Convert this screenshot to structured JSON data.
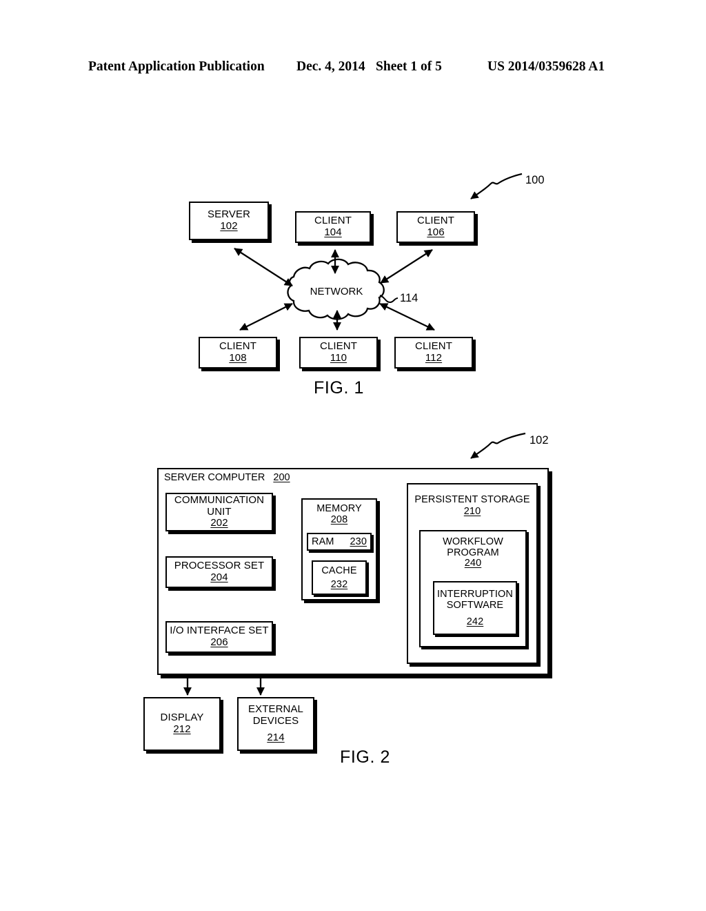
{
  "header": {
    "title": "Patent Application Publication",
    "date": "Dec. 4, 2014",
    "sheet": "Sheet 1 of 5",
    "publication_number": "US 2014/0359628 A1"
  },
  "figure1": {
    "caption": "FIG. 1",
    "system_ref": "100",
    "network": {
      "label": "NETWORK",
      "ref": "114"
    },
    "nodes": [
      {
        "label": "SERVER",
        "num": "102"
      },
      {
        "label": "CLIENT",
        "num": "104"
      },
      {
        "label": "CLIENT",
        "num": "106"
      },
      {
        "label": "CLIENT",
        "num": "108"
      },
      {
        "label": "CLIENT",
        "num": "110"
      },
      {
        "label": "CLIENT",
        "num": "112"
      }
    ]
  },
  "figure2": {
    "caption": "FIG. 2",
    "system_ref": "102",
    "container": {
      "label": "SERVER COMPUTER",
      "num": "200"
    },
    "blocks": {
      "communication_unit": {
        "line1": "COMMUNICATION",
        "line2": "UNIT",
        "num": "202"
      },
      "processor_set": {
        "label": "PROCESSOR SET",
        "num": "204"
      },
      "io_interface_set": {
        "label": "I/O INTERFACE SET",
        "num": "206"
      },
      "memory": {
        "label": "MEMORY",
        "num": "208"
      },
      "ram": {
        "label": "RAM",
        "num": "230"
      },
      "cache": {
        "label": "CACHE",
        "num": "232"
      },
      "persistent_storage": {
        "label": "PERSISTENT STORAGE",
        "num": "210"
      },
      "workflow_program": {
        "line1": "WORKFLOW",
        "line2": "PROGRAM",
        "num": "240"
      },
      "interruption_software": {
        "line1": "INTERRUPTION",
        "line2": "SOFTWARE",
        "num": "242"
      },
      "display": {
        "label": "DISPLAY",
        "num": "212"
      },
      "external_devices": {
        "line1": "EXTERNAL",
        "line2": "DEVICES",
        "num": "214"
      }
    }
  }
}
